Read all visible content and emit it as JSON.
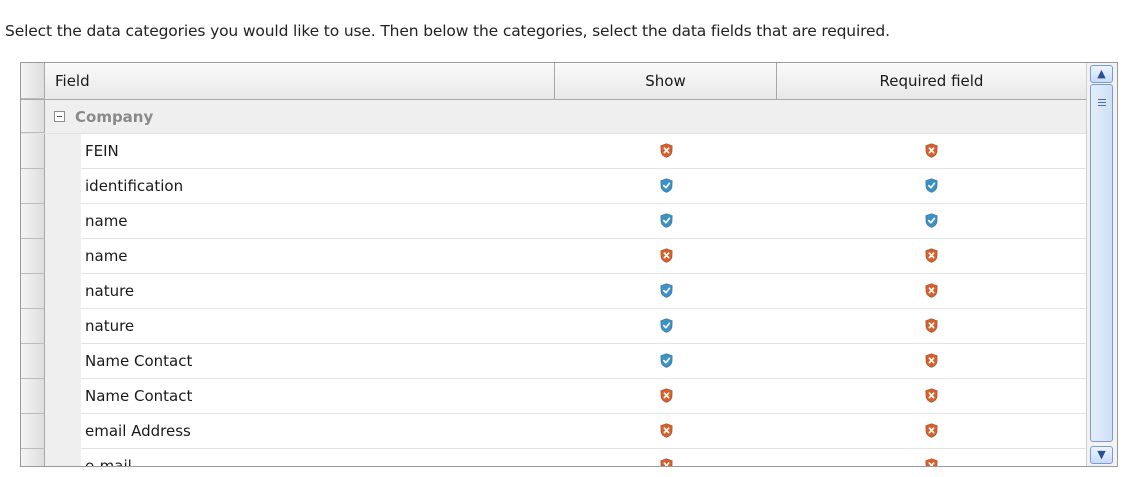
{
  "instruction": "Select the data categories you would like to use. Then below the categories, select the data fields that are required.",
  "grid": {
    "columns": {
      "field": "Field",
      "show": "Show",
      "required": "Required field"
    },
    "group": {
      "label": "Company",
      "expanded": true
    },
    "rows": [
      {
        "field": "FEIN",
        "show": "denied",
        "required": "denied"
      },
      {
        "field": "identification",
        "show": "granted",
        "required": "granted"
      },
      {
        "field": "name",
        "show": "granted",
        "required": "granted"
      },
      {
        "field": "name",
        "show": "denied",
        "required": "denied"
      },
      {
        "field": "nature",
        "show": "granted",
        "required": "denied"
      },
      {
        "field": "nature",
        "show": "granted",
        "required": "denied"
      },
      {
        "field": "Name Contact",
        "show": "granted",
        "required": "denied"
      },
      {
        "field": "Name Contact",
        "show": "denied",
        "required": "denied"
      },
      {
        "field": "email Address",
        "show": "denied",
        "required": "denied"
      },
      {
        "field": "e-mail",
        "show": "denied",
        "required": "denied"
      }
    ]
  },
  "icons": {
    "granted": "shield-check-icon",
    "denied": "shield-x-icon"
  },
  "colors": {
    "granted": "#3a93c8",
    "denied": "#d9602a"
  }
}
